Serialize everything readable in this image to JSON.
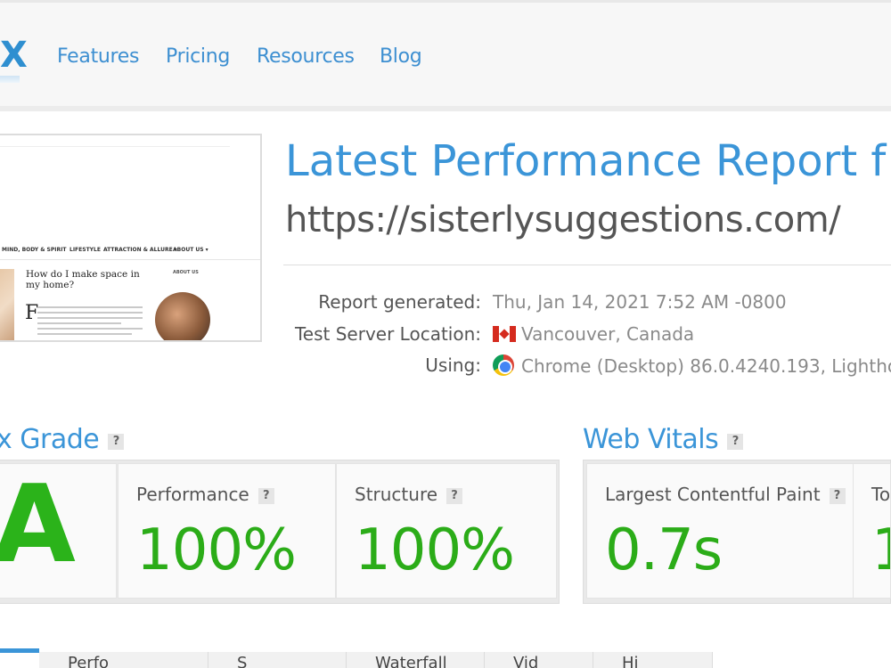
{
  "nav": {
    "logo_fragment": "X",
    "items": [
      "Features",
      "Pricing",
      "Resources",
      "Blog"
    ]
  },
  "report": {
    "title": "Latest Performance Report f",
    "url": "https://sisterlysuggestions.com/",
    "meta": [
      {
        "label": "Report generated:",
        "value": "Thu, Jan 14, 2021 7:52 AM -0800"
      },
      {
        "label": "Test Server Location:",
        "value": "Vancouver, Canada",
        "icon": "canada-flag-icon"
      },
      {
        "label": "Using:",
        "value": "Chrome (Desktop) 86.0.4240.193, Lightho",
        "icon": "chrome-icon"
      }
    ]
  },
  "thumbnail": {
    "menu": [
      "MIND, BODY & SPIRIT",
      "LIFESTYLE",
      "ATTRACTION & ALLURE ▾",
      "ABOUT US ▾"
    ],
    "post_title": "How do I make space in my home?",
    "dropcap": "F",
    "about_label": "ABOUT US"
  },
  "grades": {
    "section_title": "x Grade",
    "help": "?",
    "letter": "A",
    "cards": [
      {
        "label": "Performance",
        "value": "100%"
      },
      {
        "label": "Structure",
        "value": "100%"
      }
    ]
  },
  "vitals": {
    "section_title": "Web Vitals",
    "help": "?",
    "cards": [
      {
        "label": "Largest Contentful Paint",
        "value": "0.7s"
      },
      {
        "label": "To",
        "value": "1"
      }
    ]
  },
  "tabs": [
    "Perfo",
    "S",
    "Waterfall",
    "Vid",
    "Hi"
  ],
  "colors": {
    "accent": "#3b95d8",
    "good": "#2bac18"
  }
}
